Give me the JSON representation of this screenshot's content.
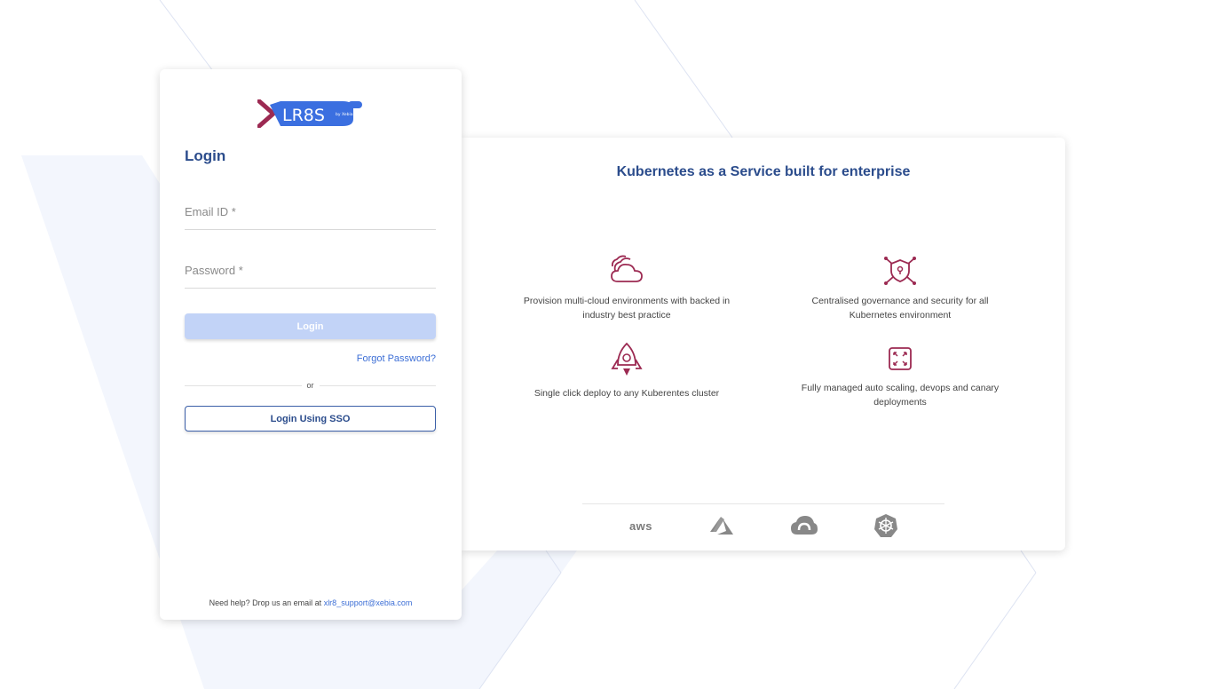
{
  "login": {
    "logo_alt": "XLR8S by Xebia",
    "title": "Login",
    "email_placeholder": "Email ID *",
    "password_placeholder": "Password *",
    "login_button": "Login",
    "forgot_password": "Forgot Password?",
    "or_text": "or",
    "sso_button": "Login Using SSO",
    "help_prefix": "Need help? Drop us an email at ",
    "help_email": "xlr8_support@xebia.com"
  },
  "info": {
    "title": "Kubernetes as a Service built for enterprise",
    "features": [
      {
        "icon": "multi-cloud-icon",
        "text": "Provision multi-cloud environments with backed in industry best practice"
      },
      {
        "icon": "shield-security-icon",
        "text": "Centralised governance and security for all Kubernetes environment"
      },
      {
        "icon": "rocket-icon",
        "text": "Single click deploy to any Kuberentes cluster"
      },
      {
        "icon": "auto-scaling-icon",
        "text": "Fully managed auto scaling, devops and canary deployments"
      }
    ],
    "providers": [
      {
        "icon": "aws-icon",
        "label": "aws"
      },
      {
        "icon": "azure-icon",
        "label": ""
      },
      {
        "icon": "google-cloud-icon",
        "label": ""
      },
      {
        "icon": "kubernetes-icon",
        "label": ""
      }
    ]
  },
  "colors": {
    "brand_blue": "#2b4c8c",
    "accent_red": "#9c2a52",
    "link_blue": "#3d6fd6",
    "disabled_button": "#c2d3f7"
  }
}
